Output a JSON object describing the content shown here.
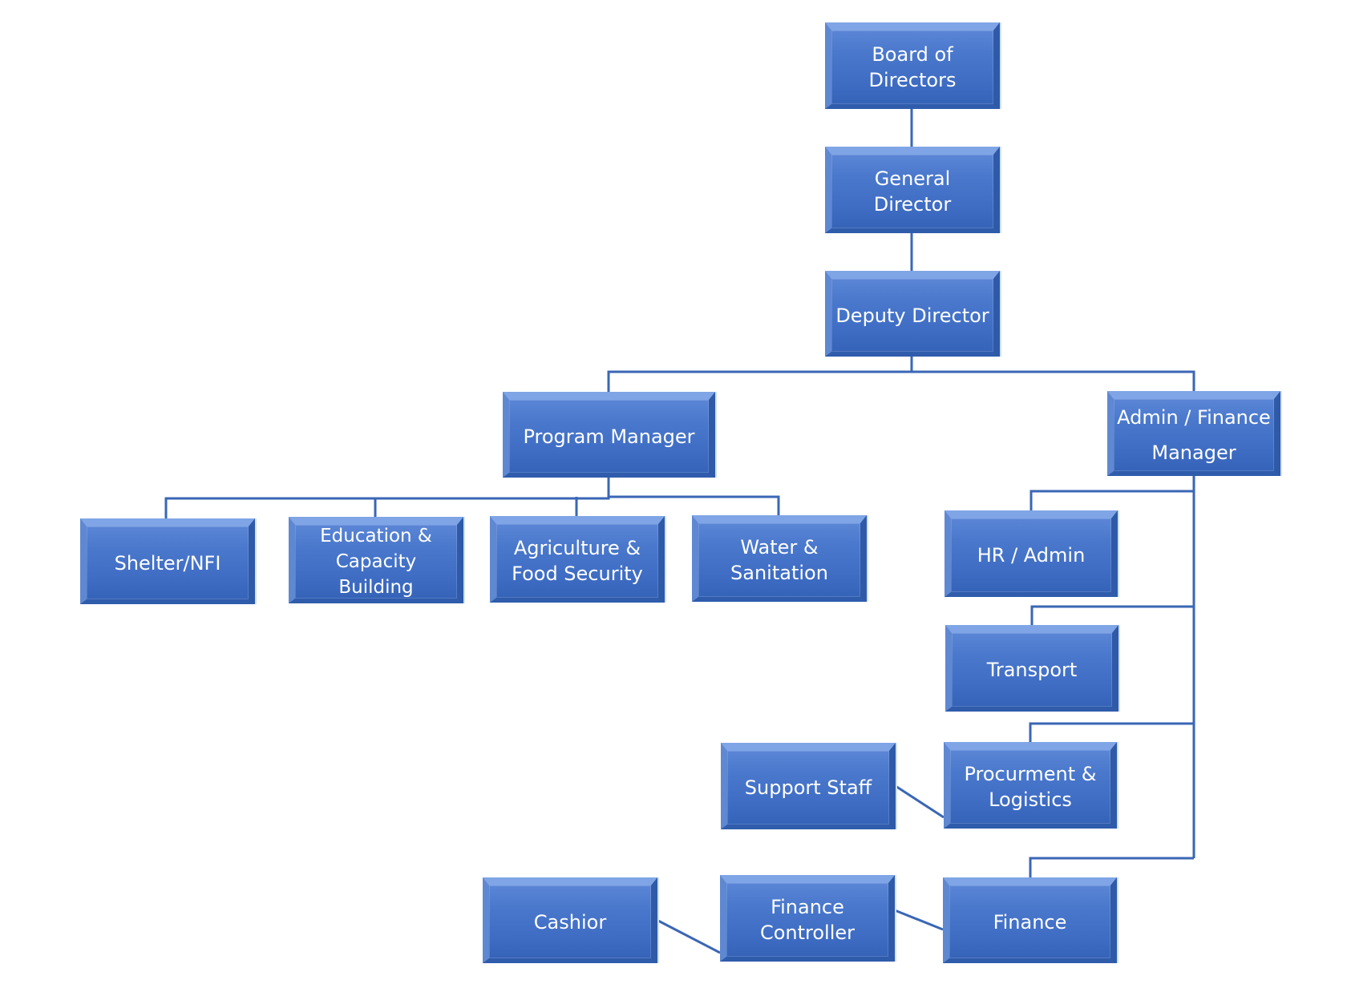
{
  "diagram": {
    "type": "org-chart",
    "colors": {
      "box": "#4472c4",
      "connector": "#3a66b5",
      "text": "#ffffff",
      "background": "#ffffff"
    },
    "nodes": {
      "board": "Board of Directors",
      "general": "General Director",
      "deputy": "Deputy Director",
      "program": "Program Manager",
      "admin": "Admin / Finance\nManager",
      "shelter": "Shelter/NFI",
      "education": "Education &\nCapacity Building",
      "agriculture": "Agriculture &\nFood Security",
      "water": "Water &\nSanitation",
      "hr": "HR / Admin",
      "transport": "Transport",
      "procurement": "Procurment &\nLogistics",
      "support": "Support Staff",
      "finance": "Finance",
      "finctrl": "Finance\nController",
      "cashier": "Cashior"
    },
    "edges": [
      [
        "board",
        "general"
      ],
      [
        "general",
        "deputy"
      ],
      [
        "deputy",
        "program"
      ],
      [
        "deputy",
        "admin"
      ],
      [
        "program",
        "shelter"
      ],
      [
        "program",
        "education"
      ],
      [
        "program",
        "agriculture"
      ],
      [
        "program",
        "water"
      ],
      [
        "admin",
        "hr"
      ],
      [
        "admin",
        "transport"
      ],
      [
        "admin",
        "procurement"
      ],
      [
        "admin",
        "finance"
      ],
      [
        "procurement",
        "support"
      ],
      [
        "finance",
        "finctrl"
      ],
      [
        "finctrl",
        "cashier"
      ]
    ]
  }
}
